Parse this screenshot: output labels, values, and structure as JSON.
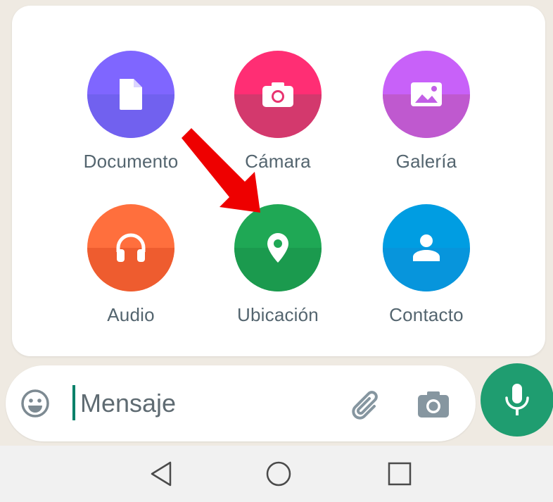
{
  "attachments": {
    "items": [
      {
        "label": "Documento",
        "icon": "document-icon",
        "color_top": "#7f66ff",
        "color_bottom": "#7161ef"
      },
      {
        "label": "Cámara",
        "icon": "camera-icon",
        "color_top": "#ff2e74",
        "color_bottom": "#d3396d"
      },
      {
        "label": "Galería",
        "icon": "gallery-icon",
        "color_top": "#c861f9",
        "color_bottom": "#bf59cf"
      },
      {
        "label": "Audio",
        "icon": "headphones-icon",
        "color_top": "#ff6f3d",
        "color_bottom": "#ee5c2f"
      },
      {
        "label": "Ubicación",
        "icon": "location-pin-icon",
        "color_top": "#1fa855",
        "color_bottom": "#1b9a4e"
      },
      {
        "label": "Contacto",
        "icon": "contact-person-icon",
        "color_top": "#009de2",
        "color_bottom": "#0795dc"
      }
    ]
  },
  "annotation": {
    "arrow_color": "#ee0000"
  },
  "input_bar": {
    "placeholder": "Mensaje",
    "emoji_icon": "emoji-icon",
    "attach_icon": "paperclip-icon",
    "camera_icon": "camera-icon",
    "mic_icon": "microphone-icon",
    "accent_color": "#1f9d70"
  },
  "nav_bar": {
    "back_icon": "back-triangle-icon",
    "home_icon": "home-circle-icon",
    "recents_icon": "recents-square-icon"
  }
}
